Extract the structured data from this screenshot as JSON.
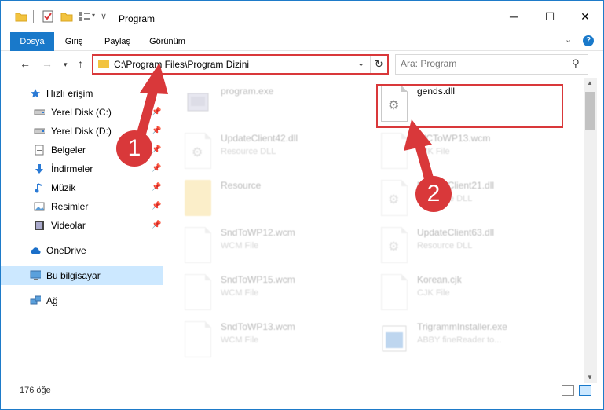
{
  "window": {
    "title": "Program",
    "minimize": "─",
    "maximize": "☐",
    "close": "✕"
  },
  "ribbon": {
    "tabs": [
      "Dosya",
      "Giriş",
      "Paylaş",
      "Görünüm"
    ],
    "expand": "⌄",
    "help": "?"
  },
  "nav": {
    "back": "←",
    "forward": "→",
    "recent": "▾",
    "up": "↑",
    "address": "C:\\Program Files\\Program Dizini",
    "address_dropdown": "⌄",
    "refresh": "↻",
    "search_placeholder": "Ara: Program",
    "search_icon": "⚲"
  },
  "sidebar": {
    "quick_access": "Hızlı erişim",
    "items": [
      {
        "label": "Yerel Disk (C:)",
        "icon": "drive-icon"
      },
      {
        "label": "Yerel Disk (D:)",
        "icon": "drive-icon"
      },
      {
        "label": "Belgeler",
        "icon": "documents-icon"
      },
      {
        "label": "İndirmeler",
        "icon": "downloads-icon"
      },
      {
        "label": "Müzik",
        "icon": "music-icon"
      },
      {
        "label": "Resimler",
        "icon": "pictures-icon"
      },
      {
        "label": "Videolar",
        "icon": "videos-icon"
      }
    ],
    "onedrive": "OneDrive",
    "this_pc": "Bu bilgisayar",
    "network": "Ağ"
  },
  "files": [
    {
      "name": "program.exe",
      "type": "",
      "highlighted": false
    },
    {
      "name": "gends.dll",
      "type": "",
      "highlighted": true
    },
    {
      "name": "UpdateClient42.dll",
      "type": "Resource DLL"
    },
    {
      "name": "WCToWP13.wcm",
      "type": "CJK File"
    },
    {
      "name": "Resource",
      "type": ""
    },
    {
      "name": "UpdateClient21.dll",
      "type": "Resource DLL"
    },
    {
      "name": "SndToWP12.wcm",
      "type": "WCM File"
    },
    {
      "name": "UpdateClient63.dll",
      "type": "Resource DLL"
    },
    {
      "name": "SndToWP15.wcm",
      "type": "WCM File"
    },
    {
      "name": "Korean.cjk",
      "type": "CJK File"
    },
    {
      "name": "SndToWP13.wcm",
      "type": "WCM File"
    },
    {
      "name": "TrigrammInstaller.exe",
      "type": "ABBY fineReader to..."
    }
  ],
  "status": {
    "count": "176 öğe"
  },
  "annotations": {
    "badge1": "1",
    "badge2": "2",
    "color": "#d9383a"
  }
}
